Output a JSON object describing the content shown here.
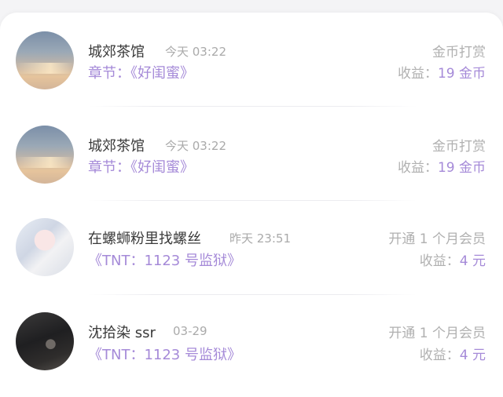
{
  "records": [
    {
      "name": "城郊茶馆",
      "time": "今天 03:22",
      "subtitle": "章节：《好闺蜜》",
      "action": "金币打赏",
      "income_label": "收益：",
      "income_value": "19 金币"
    },
    {
      "name": "城郊茶馆",
      "time": "今天 03:22",
      "subtitle": "章节：《好闺蜜》",
      "action": "金币打赏",
      "income_label": "收益：",
      "income_value": "19 金币"
    },
    {
      "name": "在螺蛳粉里找螺丝",
      "time": "昨天 23:51",
      "subtitle": "《TNT：1123 号监狱》",
      "action": "开通 1 个月会员",
      "income_label": "收益：",
      "income_value": "4 元"
    },
    {
      "name": "沈拾染 ssr",
      "time": "03-29",
      "subtitle": "《TNT：1123 号监狱》",
      "action": "开通 1 个月会员",
      "income_label": "收益：",
      "income_value": "4 元"
    }
  ]
}
